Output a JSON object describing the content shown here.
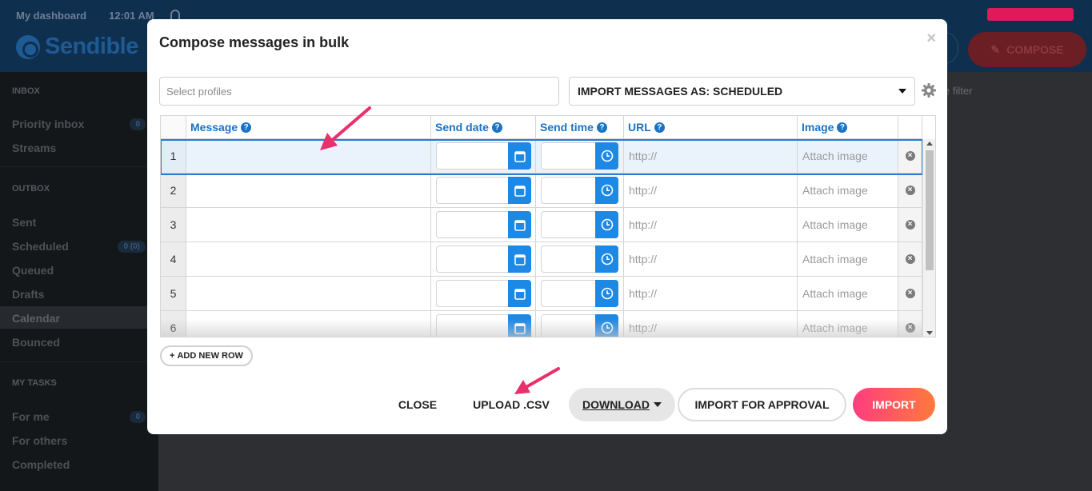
{
  "header": {
    "dashboard_label": "My dashboard",
    "time": "12:01 AM",
    "brand": "Sendible",
    "compose_label": "COMPOSE",
    "filter_placeholder": "e filter"
  },
  "sidebar": {
    "sections": [
      {
        "heading": "INBOX",
        "items": [
          {
            "label": "Priority inbox",
            "count": "0"
          },
          {
            "label": "Streams",
            "count": ""
          }
        ]
      },
      {
        "heading": "OUTBOX",
        "items": [
          {
            "label": "Sent",
            "count": ""
          },
          {
            "label": "Scheduled",
            "count": "0 (0)"
          },
          {
            "label": "Queued",
            "count": ""
          },
          {
            "label": "Drafts",
            "count": ""
          },
          {
            "label": "Calendar",
            "count": ""
          },
          {
            "label": "Bounced",
            "count": ""
          }
        ]
      },
      {
        "heading": "MY TASKS",
        "items": [
          {
            "label": "For me",
            "count": "0"
          },
          {
            "label": "For others",
            "count": ""
          },
          {
            "label": "Completed",
            "count": ""
          }
        ]
      }
    ],
    "active_item": "Calendar"
  },
  "modal": {
    "title": "Compose messages in bulk",
    "close_glyph": "×",
    "profiles_placeholder": "Select profiles",
    "import_as_label": "IMPORT MESSAGES AS: SCHEDULED",
    "columns": [
      "Message",
      "Send date",
      "Send time",
      "URL",
      "Image"
    ],
    "help_glyph": "?",
    "rows": [
      {
        "num": "1",
        "url": "http://",
        "image": "Attach image"
      },
      {
        "num": "2",
        "url": "http://",
        "image": "Attach image"
      },
      {
        "num": "3",
        "url": "http://",
        "image": "Attach image"
      },
      {
        "num": "4",
        "url": "http://",
        "image": "Attach image"
      },
      {
        "num": "5",
        "url": "http://",
        "image": "Attach image"
      },
      {
        "num": "6",
        "url": "http://",
        "image": "Attach image"
      }
    ],
    "selected_row": "1",
    "add_row_label": "ADD NEW ROW",
    "add_row_glyph": "+",
    "footer": {
      "close": "CLOSE",
      "upload": "UPLOAD .CSV",
      "download": "DOWNLOAD",
      "approval": "IMPORT FOR APPROVAL",
      "import": "IMPORT"
    }
  },
  "colors": {
    "accent_blue": "#1e88e5",
    "header_blue": "#1a73c4",
    "import_gradient_start": "#ff3d7f",
    "import_gradient_end": "#ff7a3d",
    "annotation_arrow": "#e8306a"
  }
}
